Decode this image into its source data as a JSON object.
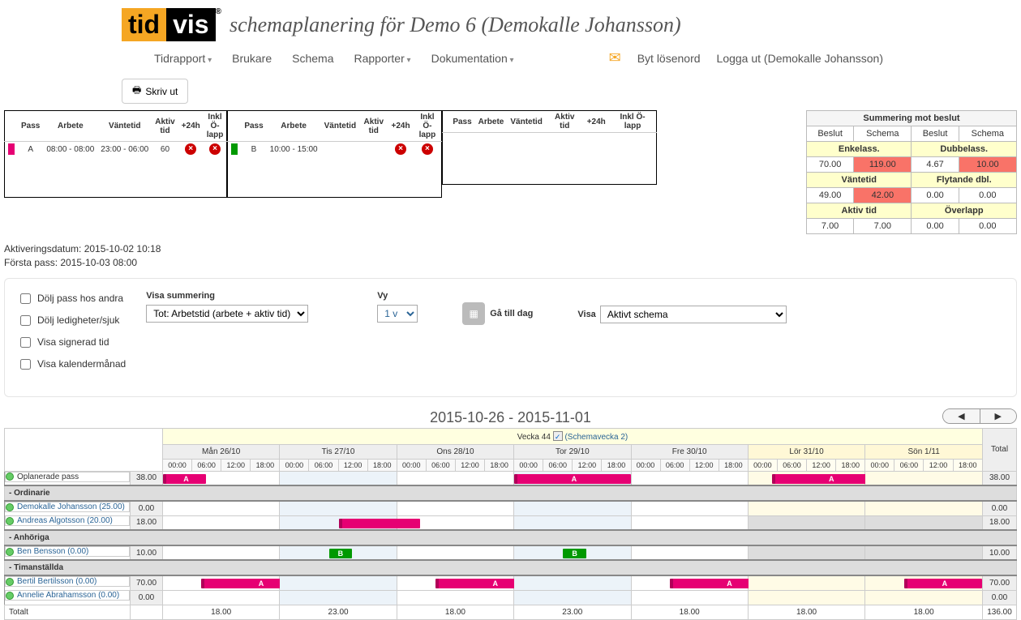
{
  "logo": {
    "left": "tid",
    "right": "vis"
  },
  "page_title": "schemaplanering för Demo 6 (Demokalle Johansson)",
  "nav": {
    "tidrapport": "Tidrapport",
    "brukare": "Brukare",
    "schema": "Schema",
    "rapporter": "Rapporter",
    "dokumentation": "Dokumentation",
    "byt_losenord": "Byt lösenord",
    "logga_ut": "Logga ut (Demokalle Johansson)"
  },
  "print_btn": "Skriv ut",
  "pass_headers": {
    "pass": "Pass",
    "arbete": "Arbete",
    "vantetid": "Väntetid",
    "aktiv_tid": "Aktiv tid",
    "p24h": "+24h",
    "inkl": "Inkl Ö-lapp"
  },
  "pass_a": {
    "label": "A",
    "arbete": "08:00 - 08:00",
    "vantetid": "23:00 - 06:00",
    "aktiv": "60"
  },
  "pass_b": {
    "label": "B",
    "arbete": "10:00 - 15:00"
  },
  "summering": {
    "title": "Summering mot beslut",
    "beslut": "Beslut",
    "schema": "Schema",
    "enkel": "Enkelass.",
    "dubbel": "Dubbelass.",
    "enkel_b": "70.00",
    "enkel_s": "119.00",
    "dubbel_b": "4.67",
    "dubbel_s": "10.00",
    "vantetid": "Väntetid",
    "flytande": "Flytande dbl.",
    "vant_b": "49.00",
    "vant_s": "42.00",
    "flyt_b": "0.00",
    "flyt_s": "0.00",
    "aktiv": "Aktiv tid",
    "overlapp": "Överlapp",
    "aktiv_b": "7.00",
    "aktiv_s": "7.00",
    "over_b": "0.00",
    "over_s": "0.00"
  },
  "info": {
    "aktivering": "Aktiveringsdatum: 2015-10-02 10:18",
    "forsta": "Första pass: 2015-10-03 08:00"
  },
  "filters": {
    "dolj_pass": "Dölj pass hos andra",
    "dolj_ledig": "Dölj ledigheter/sjuk",
    "visa_sign": "Visa signerad tid",
    "visa_kal": "Visa kalendermånad",
    "visa_sum_label": "Visa summering",
    "visa_sum_value": "Tot: Arbetstid (arbete + aktiv tid)",
    "vy_label": "Vy",
    "vy_value": "1 v",
    "ga_till_dag": "Gå till dag",
    "visa_label": "Visa",
    "visa_value": "Aktivt schema"
  },
  "date_range": "2015-10-26 - 2015-11-01",
  "vecka": "Vecka 44",
  "schemavecka": "(Schemavecka 2)",
  "total_label": "Total",
  "days": [
    {
      "label": "Mån 26/10",
      "weekend": false
    },
    {
      "label": "Tis 27/10",
      "weekend": false
    },
    {
      "label": "Ons 28/10",
      "weekend": false
    },
    {
      "label": "Tor 29/10",
      "weekend": false
    },
    {
      "label": "Fre 30/10",
      "weekend": false
    },
    {
      "label": "Lör 31/10",
      "weekend": true
    },
    {
      "label": "Sön 1/11",
      "weekend": true
    }
  ],
  "hours": [
    "00:00",
    "06:00",
    "12:00",
    "18:00"
  ],
  "sections": {
    "oplanerade": "Oplanerade pass",
    "ordinarie": "- Ordinarie",
    "anhoriga": "- Anhöriga",
    "timanstallda": "- Timanställda"
  },
  "rows": {
    "oplanerade": {
      "num": "38.00",
      "total": "38.00"
    },
    "demokalle": {
      "name": "Demokalle Johansson (25.00)",
      "num": "0.00",
      "total": "0.00"
    },
    "andreas": {
      "name": "Andreas Algotsson (20.00)",
      "num": "18.00",
      "total": "18.00"
    },
    "ben": {
      "name": "Ben Bensson (0.00)",
      "num": "10.00",
      "total": "10.00"
    },
    "bertil": {
      "name": "Bertil Bertilsson (0.00)",
      "num": "70.00",
      "total": "70.00"
    },
    "annelie": {
      "name": "Annelie Abrahamsson (0.00)",
      "num": "0.00",
      "total": "0.00"
    }
  },
  "footer": {
    "label": "Totalt",
    "d0": "18.00",
    "d1": "23.00",
    "d2": "18.00",
    "d3": "23.00",
    "d4": "18.00",
    "d5": "18.00",
    "d6": "18.00",
    "total": "136.00"
  },
  "bar_a": "A",
  "bar_b": "B"
}
